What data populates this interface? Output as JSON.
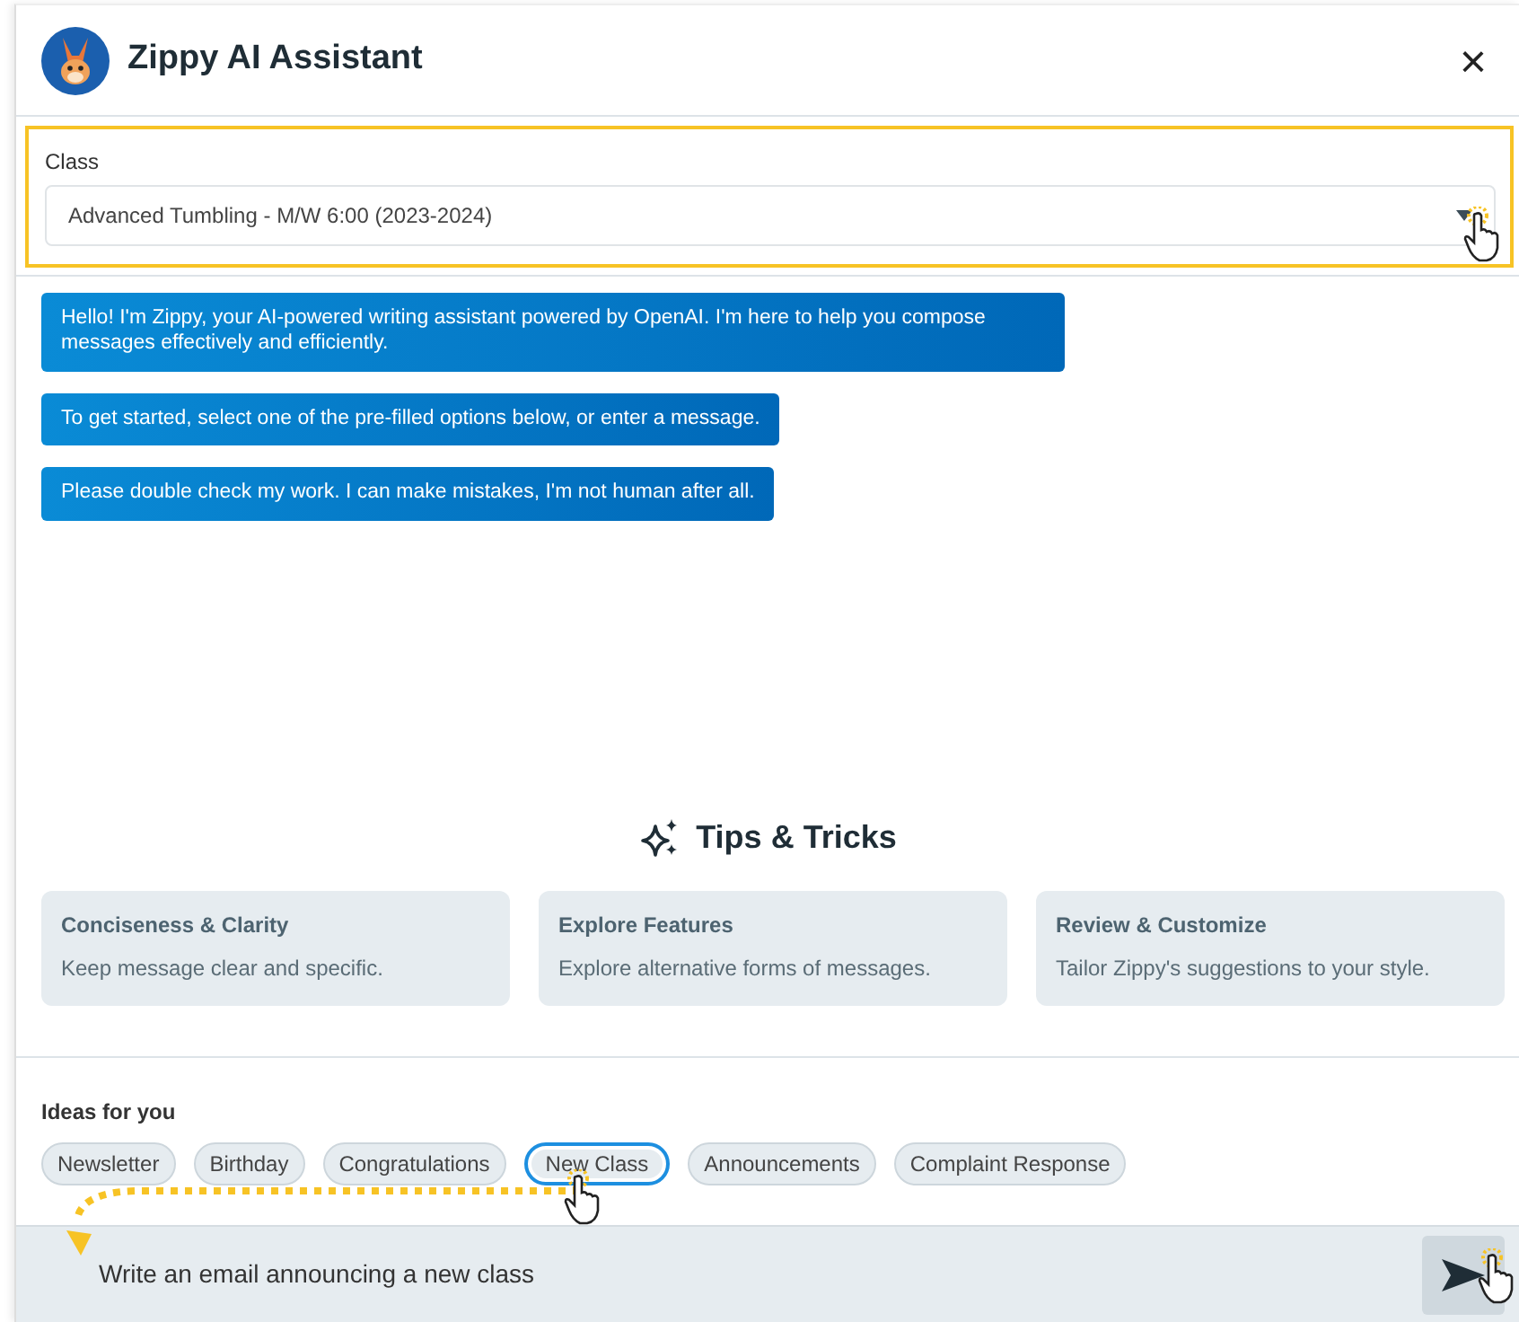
{
  "header": {
    "title": "Zippy AI Assistant",
    "close": "×"
  },
  "class_field": {
    "label": "Class",
    "value": "Advanced Tumbling - M/W 6:00 (2023-2024)",
    "highlighted": true
  },
  "messages": [
    {
      "text": "Hello! I'm Zippy, your AI-powered writing assistant powered by OpenAI. I'm here to help you compose messages effectively and efficiently."
    },
    {
      "text": "To get started, select one of the pre-filled options below, or enter a message."
    },
    {
      "text": "Please double check my work. I can make mistakes, I'm not human after all."
    }
  ],
  "tips": {
    "title": "Tips & Tricks",
    "cards": [
      {
        "title": "Conciseness & Clarity",
        "text": "Keep message clear and specific."
      },
      {
        "title": "Explore Features",
        "text": "Explore alternative forms of messages."
      },
      {
        "title": "Review & Customize",
        "text": "Tailor Zippy's suggestions to your style."
      }
    ]
  },
  "ideas": {
    "label": "Ideas for you",
    "chips": [
      {
        "label": "Newsletter",
        "selected": false
      },
      {
        "label": "Birthday",
        "selected": false
      },
      {
        "label": "Congratulations",
        "selected": false
      },
      {
        "label": "New Class",
        "selected": true
      },
      {
        "label": "Announcements",
        "selected": false
      },
      {
        "label": "Complaint Response",
        "selected": false
      }
    ]
  },
  "composer": {
    "value": "Write an email announcing a new class"
  }
}
